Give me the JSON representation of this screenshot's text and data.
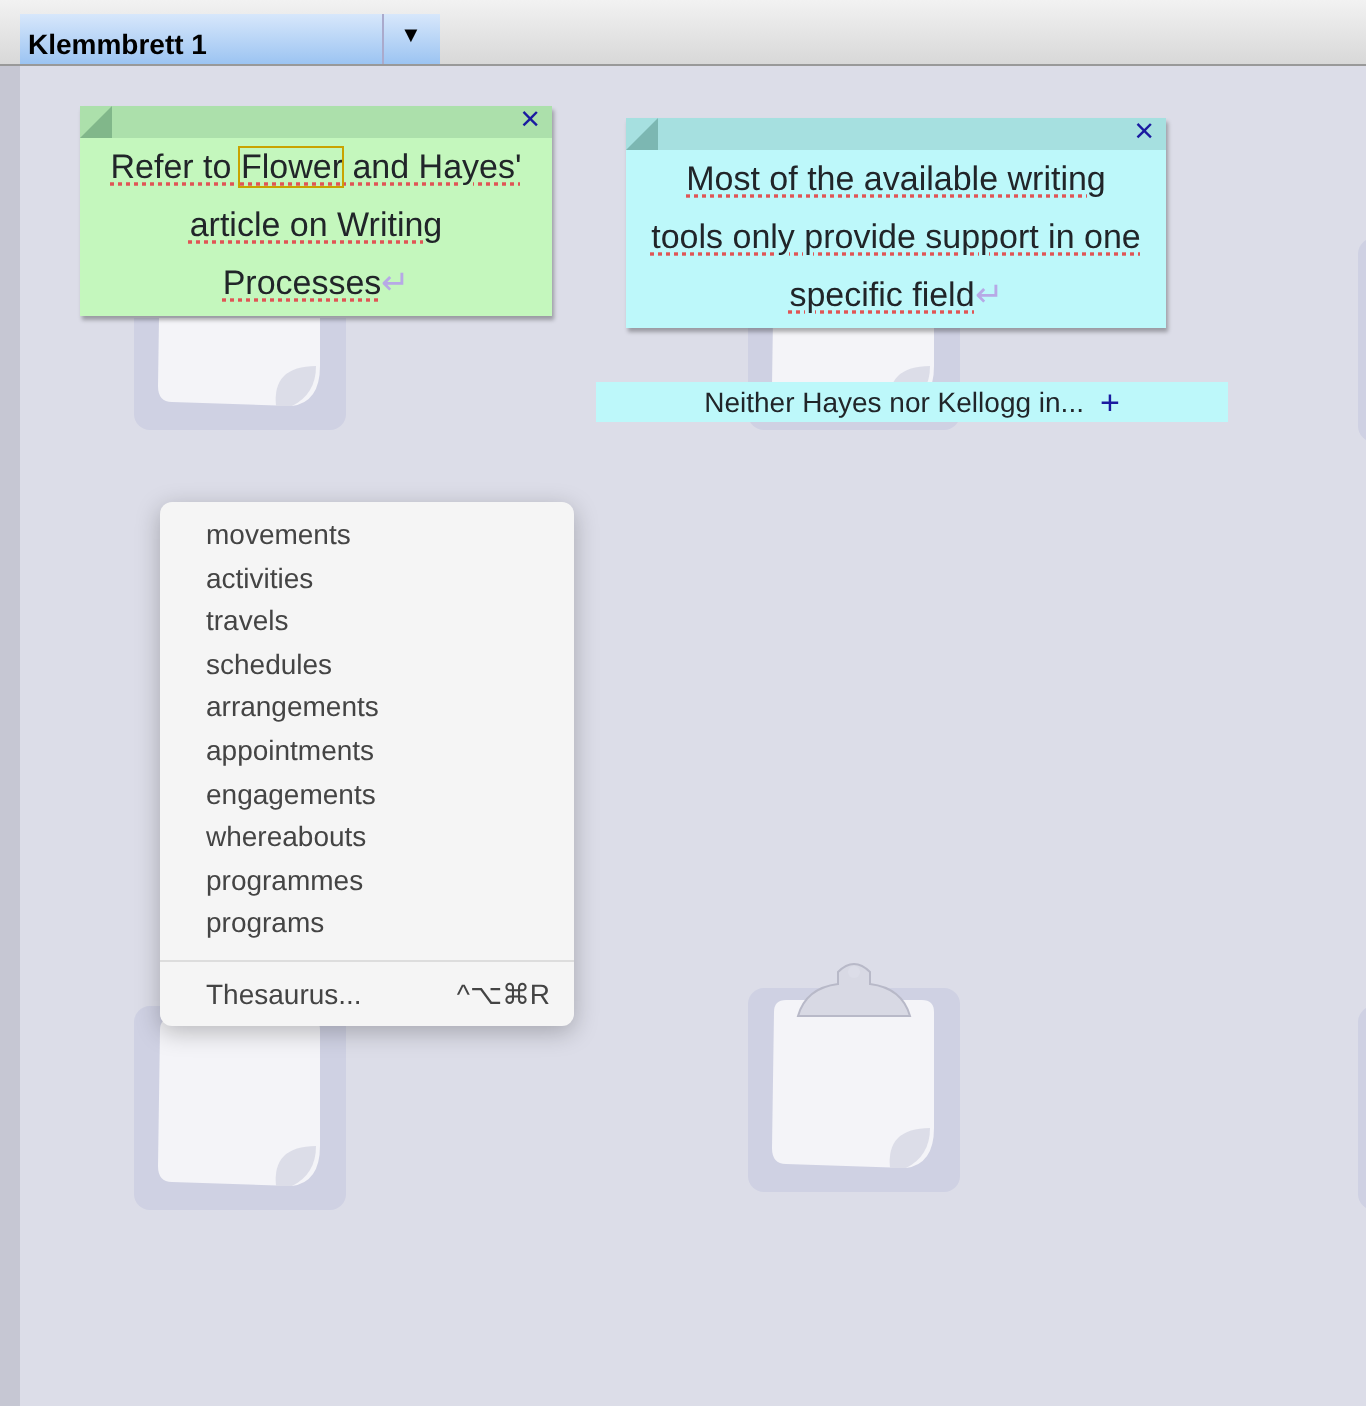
{
  "tabs": [
    {
      "label": "Klemmbrett 1",
      "selected": true,
      "menu": "▼"
    }
  ],
  "notes": [
    {
      "color": "#c4f7bd",
      "close": "×",
      "spellcheck": true,
      "end_mark": "↵",
      "segments": [
        {
          "text": "Refer to "
        },
        {
          "text": "Flower",
          "boxed": true
        },
        {
          "text": " and Hayes' article on Writing Processes"
        }
      ]
    },
    {
      "color": "#bdf8fa",
      "close": "×",
      "spellcheck": true,
      "end_mark": "↵",
      "segments": [
        {
          "text": "Most of the available writing tools only provide support in one specific field"
        }
      ]
    }
  ],
  "label": {
    "text": "Neither Hayes nor Kellogg in...",
    "action": "+"
  },
  "context_menu": {
    "items": [
      "movements",
      "activities",
      "travels",
      "schedules",
      "arrangements",
      "appointments",
      "engagements",
      "whereabouts",
      "programmes",
      "programs"
    ],
    "footer": {
      "label": "Thesaurus...",
      "shortcut": "^⌥⌘R"
    }
  }
}
